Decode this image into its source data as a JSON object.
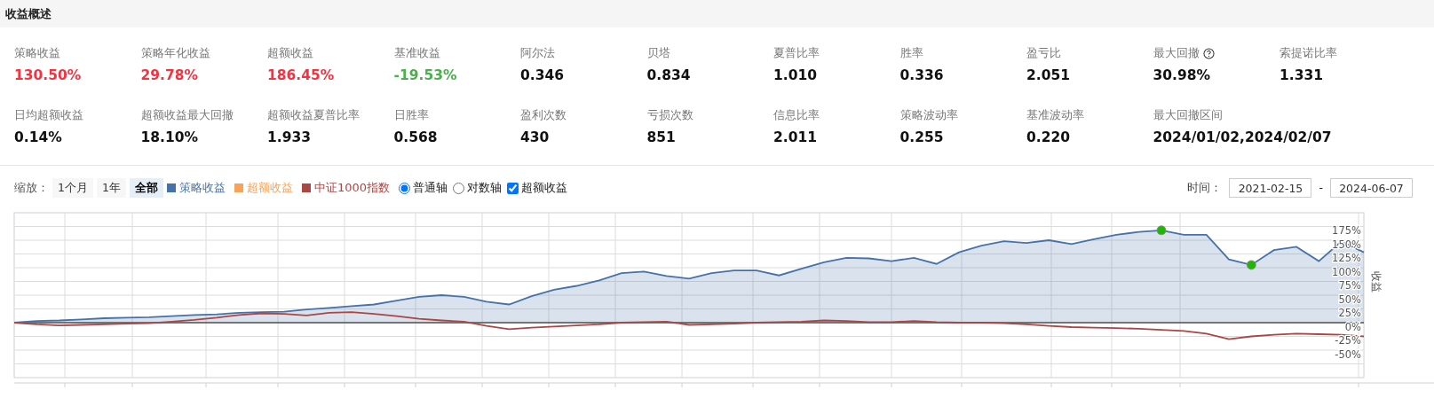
{
  "section_title": "收益概述",
  "metrics": [
    [
      {
        "label": "策略收益",
        "value": "130.50%",
        "color": "#f5333f"
      },
      {
        "label": "策略年化收益",
        "value": "29.78%",
        "color": "#f5333f"
      },
      {
        "label": "超额收益",
        "value": "186.45%",
        "color": "#f5333f"
      },
      {
        "label": "基准收益",
        "value": "-19.53%",
        "color": "#4cae4c"
      },
      {
        "label": "阿尔法",
        "value": "0.346",
        "color": "#111111"
      },
      {
        "label": "贝塔",
        "value": "0.834",
        "color": "#111111"
      },
      {
        "label": "夏普比率",
        "value": "1.010",
        "color": "#111111"
      },
      {
        "label": "胜率",
        "value": "0.336",
        "color": "#111111"
      },
      {
        "label": "盈亏比",
        "value": "2.051",
        "color": "#111111"
      },
      {
        "label": "最大回撤",
        "value": "30.98%",
        "color": "#111111",
        "help": true
      },
      {
        "label": "索提诺比率",
        "value": "1.331",
        "color": "#111111"
      }
    ],
    [
      {
        "label": "日均超额收益",
        "value": "0.14%",
        "color": "#111111"
      },
      {
        "label": "超额收益最大回撤",
        "value": "18.10%",
        "color": "#111111"
      },
      {
        "label": "超额收益夏普比率",
        "value": "1.933",
        "color": "#111111"
      },
      {
        "label": "日胜率",
        "value": "0.568",
        "color": "#111111"
      },
      {
        "label": "盈利次数",
        "value": "430",
        "color": "#111111"
      },
      {
        "label": "亏损次数",
        "value": "851",
        "color": "#111111"
      },
      {
        "label": "信息比率",
        "value": "2.011",
        "color": "#111111"
      },
      {
        "label": "策略波动率",
        "value": "0.255",
        "color": "#111111"
      },
      {
        "label": "基准波动率",
        "value": "0.220",
        "color": "#111111"
      },
      {
        "label": "最大回撤区间",
        "value": "2024/01/02,2024/02/07",
        "color": "#111111"
      }
    ]
  ],
  "toolbar": {
    "zoom_label": "缩放：",
    "zoom_buttons": [
      {
        "label": "1个月",
        "selected": false
      },
      {
        "label": "1年",
        "selected": false
      },
      {
        "label": "全部",
        "selected": true
      }
    ],
    "legend": [
      {
        "kind": "series"
      },
      {
        "kind": "extra",
        "label": "超额收益",
        "color": "#f7a35c"
      },
      {
        "kind": "series"
      }
    ],
    "axis_options": [
      {
        "label": "普通轴",
        "selected": true
      },
      {
        "label": "对数轴",
        "selected": false
      }
    ],
    "excess_toggle": {
      "label": "超额收益",
      "checked": true
    },
    "time_label": "时间：",
    "start_date": "2021-02-15",
    "date_separator": "-",
    "end_date": "2024-06-07"
  },
  "chart": {
    "chart_data": {
      "type": "line",
      "grid": true,
      "ylabel": "收益",
      "ylim": [
        -100,
        200
      ],
      "yticks": [
        {
          "value": -50,
          "label": "-50%"
        },
        {
          "value": -25,
          "label": "-25%"
        },
        {
          "value": 0,
          "label": "0%"
        },
        {
          "value": 25,
          "label": "25%"
        },
        {
          "value": 50,
          "label": "50%"
        },
        {
          "value": 75,
          "label": "75%"
        },
        {
          "value": 100,
          "label": "100%"
        },
        {
          "value": 125,
          "label": "125%"
        },
        {
          "value": 150,
          "label": "150%"
        },
        {
          "value": 175,
          "label": "175%"
        }
      ],
      "series": [
        {
          "name": "策略收益",
          "color": "#4572a7",
          "values": [
            0,
            3,
            4,
            6,
            8,
            9,
            10,
            12,
            14,
            15,
            18,
            19,
            20,
            24,
            27,
            30,
            33,
            40,
            47,
            50,
            47,
            38,
            33,
            48,
            60,
            67,
            77,
            90,
            93,
            85,
            80,
            90,
            95,
            95,
            86,
            98,
            110,
            118,
            117,
            112,
            118,
            107,
            128,
            140,
            148,
            145,
            150,
            143,
            152,
            160,
            165,
            168,
            160,
            160,
            115,
            105,
            132,
            138,
            112,
            148,
            128
          ]
        },
        {
          "name": "中证1000指数",
          "color": "#aa4643",
          "values": [
            0,
            -3,
            -5,
            -4,
            -3,
            -2,
            -1,
            2,
            5,
            9,
            14,
            17,
            16,
            13,
            18,
            19,
            16,
            12,
            7,
            4,
            2,
            -6,
            -12,
            -9,
            -7,
            -5,
            -3,
            0,
            1,
            2,
            -4,
            -3,
            -2,
            0,
            1,
            2,
            4,
            3,
            1,
            1,
            3,
            1,
            0,
            0,
            -1,
            -3,
            -6,
            -8,
            -9,
            -10,
            -11,
            -13,
            -15,
            -20,
            -30,
            -25,
            -22,
            -20,
            -21,
            -22,
            -25
          ]
        }
      ]
    }
  }
}
